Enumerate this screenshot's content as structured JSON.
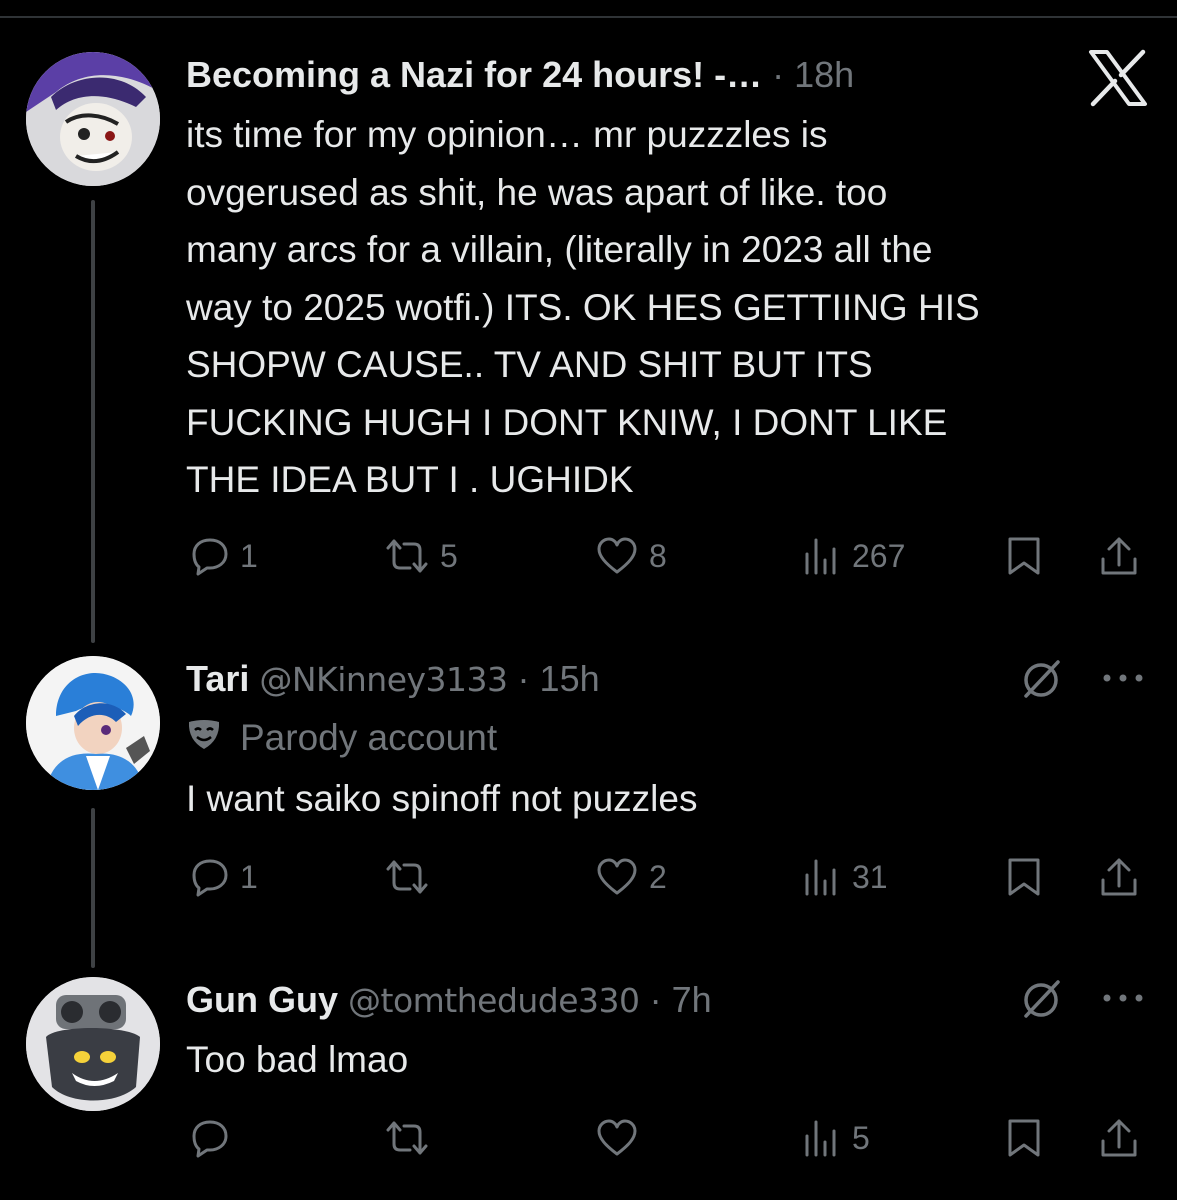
{
  "close_label": "X",
  "tweets": [
    {
      "name": "Becoming a Nazi for 24 hours! -…",
      "handle": "",
      "time": "18h",
      "parody": "",
      "lines": [
        "its time for my opinion… mr puzzzles is",
        "ovgerused as shit, he was apart of like. too",
        "many arcs for a villain, (literally in 2023 all the",
        "way to 2025 wotfi.) ITS. OK HES GETTIING HIS",
        "SHOPW CAUSE.. TV AND SHIT BUT ITS",
        "FUCKING HUGH I DONT KNIW, I DONT LIKE",
        "THE IDEA BUT I . UGHIDK"
      ],
      "replies": "1",
      "reposts": "5",
      "likes": "8",
      "views": "267"
    },
    {
      "name": "Tari",
      "handle": "@NKinney3133",
      "time": "15h",
      "parody": "Parody account",
      "lines": [
        "I want saiko spinoff not puzzles"
      ],
      "replies": "1",
      "reposts": "",
      "likes": "2",
      "views": "31"
    },
    {
      "name": "Gun Guy",
      "handle": "@tomthedude330",
      "time": "7h",
      "parody": "",
      "lines": [
        "Too bad lmao"
      ],
      "replies": "",
      "reposts": "",
      "likes": "",
      "views": "5"
    }
  ],
  "colors": {
    "background": "#000000",
    "text": "#e7e9ea",
    "muted": "#71767b",
    "thread_line": "#3e4144"
  },
  "icons": [
    "reply-icon",
    "repost-icon",
    "like-icon",
    "views-icon",
    "bookmark-icon",
    "share-icon",
    "grok-icon",
    "more-icon",
    "parody-mask-icon",
    "x-logo-icon"
  ]
}
